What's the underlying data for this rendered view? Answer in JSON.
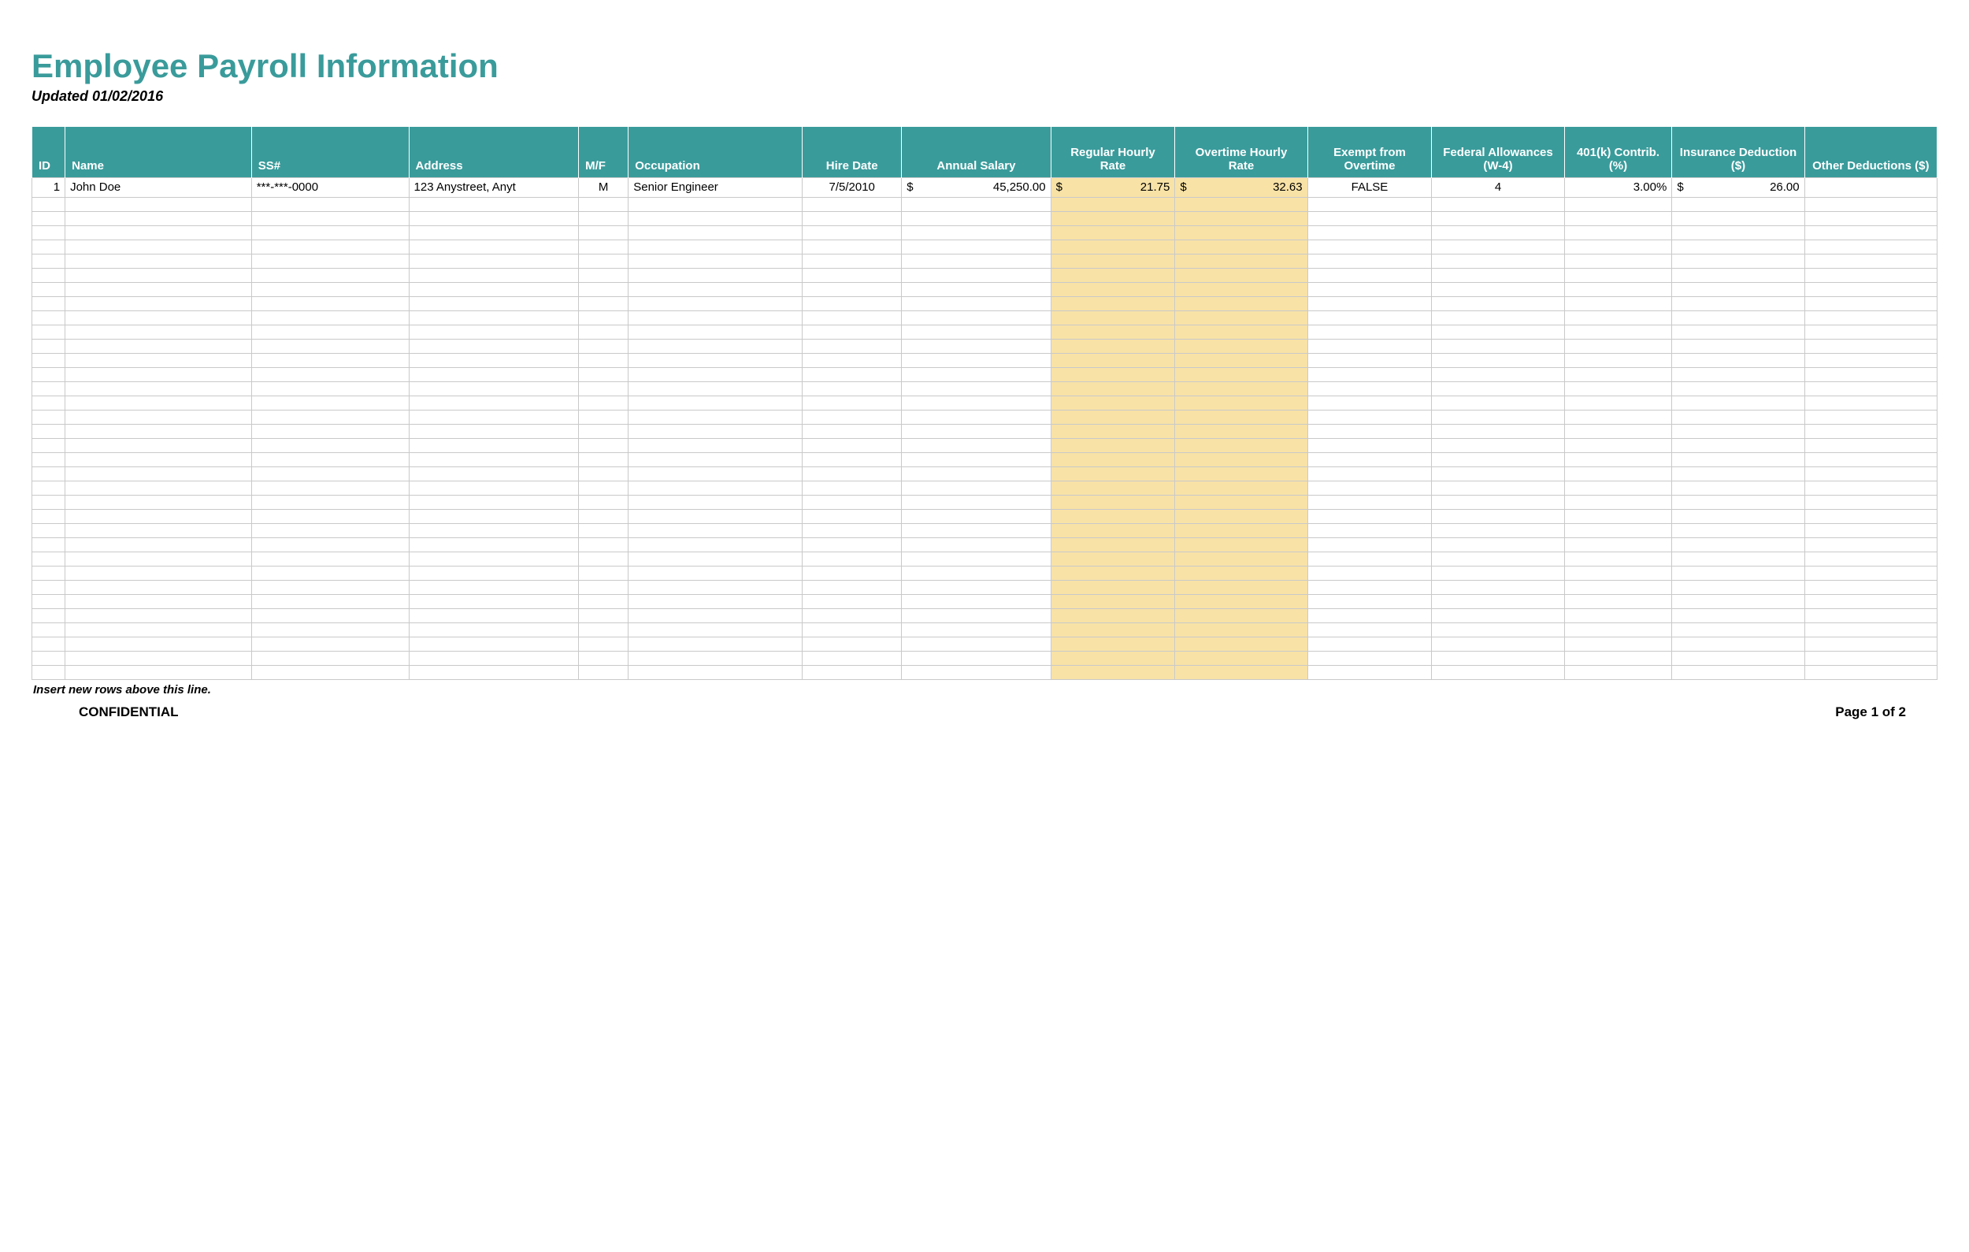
{
  "title": "Employee Payroll Information",
  "subtitle": "Updated 01/02/2016",
  "columns": {
    "id": "ID",
    "name": "Name",
    "ss": "SS#",
    "address": "Address",
    "mf": "M/F",
    "occupation": "Occupation",
    "hire_date": "Hire Date",
    "annual_salary": "Annual Salary",
    "regular_hourly_rate": "Regular Hourly Rate",
    "overtime_hourly_rate": "Overtime Hourly Rate",
    "exempt_from_overtime": "Exempt from Overtime",
    "federal_allowances": "Federal Allowances (W-4)",
    "k401_contrib": "401(k) Contrib. (%)",
    "insurance_deduction": "Insurance Deduction ($)",
    "other_deductions": "Other Deductions ($)"
  },
  "row": {
    "id": "1",
    "name": "John Doe",
    "ss": "***-***-0000",
    "address": "123 Anystreet, Anyt",
    "mf": "M",
    "occupation": "Senior Engineer",
    "hire_date": "7/5/2010",
    "annual_salary_sym": "$",
    "annual_salary": "45,250.00",
    "regular_rate_sym": "$",
    "regular_rate": "21.75",
    "overtime_rate_sym": "$",
    "overtime_rate": "32.63",
    "exempt": "FALSE",
    "federal_allowances": "4",
    "k401": "3.00%",
    "insurance_sym": "$",
    "insurance": "26.00",
    "other": ""
  },
  "empty_row_count": 34,
  "insert_note": "Insert new rows above this line.",
  "footer": {
    "confidential": "CONFIDENTIAL",
    "page": "Page 1 of 2"
  }
}
